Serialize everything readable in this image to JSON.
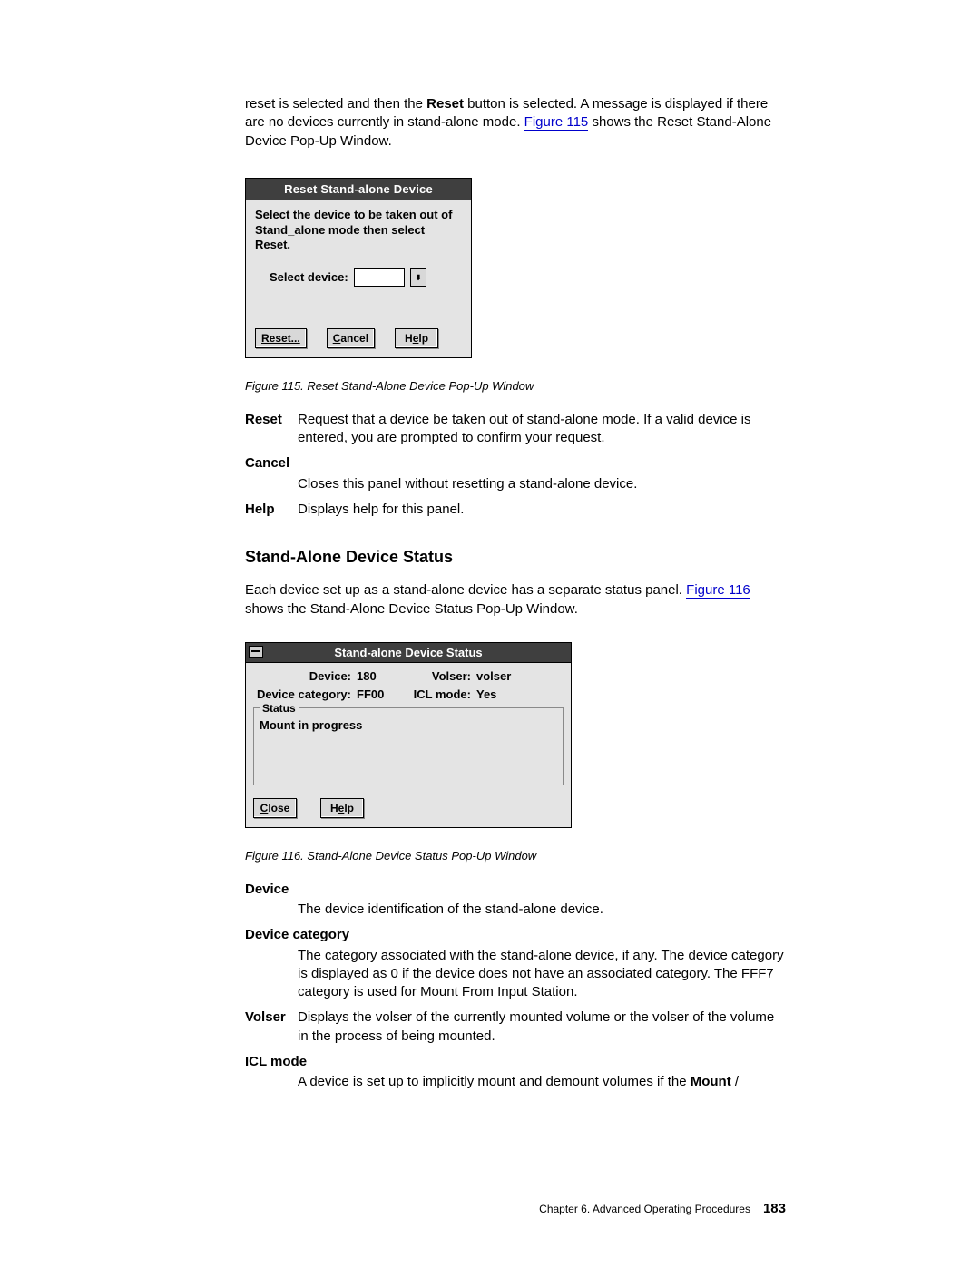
{
  "intro_para": {
    "t1": "reset is selected and then the ",
    "t2": "Reset",
    "t3": " button is selected. A message is displayed if there are no devices currently in stand-alone mode. ",
    "link": "Figure 115",
    "t4": " shows the Reset Stand-Alone Device Pop-Up Window."
  },
  "dialog1": {
    "title": "Reset Stand-alone Device",
    "instruction": "Select the device to be taken out of Stand_alone mode then select Reset.",
    "select_label": "Select device:",
    "btn_reset": "Reset...",
    "btn_cancel_u": "C",
    "btn_cancel_rest": "ancel",
    "btn_help_pre": "H",
    "btn_help_u": "e",
    "btn_help_rest": "lp"
  },
  "fig115_caption": "Figure 115. Reset Stand-Alone Device Pop-Up Window",
  "defs1": {
    "reset": {
      "term": "Reset",
      "desc": "Request that a device be taken out of stand-alone mode. If a valid device is entered, you are prompted to confirm your request."
    },
    "cancel": {
      "term": "Cancel",
      "desc": "Closes this panel without resetting a stand-alone device."
    },
    "help": {
      "term": "Help",
      "desc": "Displays help for this panel."
    }
  },
  "section_heading": "Stand-Alone Device Status",
  "section_para": {
    "t1": "Each device set up as a stand-alone device has a separate status panel. ",
    "link": "Figure 116",
    "t2": " shows the Stand-Alone Device Status Pop-Up Window."
  },
  "dialog2": {
    "title": "Stand-alone Device Status",
    "device_lbl": "Device:",
    "device_val": "180",
    "volser_lbl": "Volser:",
    "volser_val": "volser",
    "cat_lbl": "Device category:",
    "cat_val": "FF00",
    "icl_lbl": "ICL mode:",
    "icl_val": "Yes",
    "status_legend": "Status",
    "status_text": "Mount in progress",
    "btn_close_u": "C",
    "btn_close_rest": "lose",
    "btn_help_pre": "H",
    "btn_help_u": "e",
    "btn_help_rest": "lp"
  },
  "fig116_caption": "Figure 116. Stand-Alone Device Status Pop-Up Window",
  "defs2": {
    "device": {
      "term": "Device",
      "desc": "The device identification of the stand-alone device."
    },
    "devcat": {
      "term": "Device category",
      "desc": "The category associated with the stand-alone device, if any. The device category is displayed as 0 if the device does not have an associated category. The FFF7 category is used for Mount From Input Station."
    },
    "volser": {
      "term": "Volser",
      "desc": "Displays the volser of the currently mounted volume or the volser of the volume in the process of being mounted."
    },
    "icl": {
      "term": "ICL mode",
      "desc_pre": "A device is set up to implicitly mount and demount volumes if the ",
      "desc_bold": "Mount",
      "desc_post": " /"
    }
  },
  "footer": {
    "chapter": "Chapter 6. Advanced Operating Procedures",
    "page": "183"
  }
}
